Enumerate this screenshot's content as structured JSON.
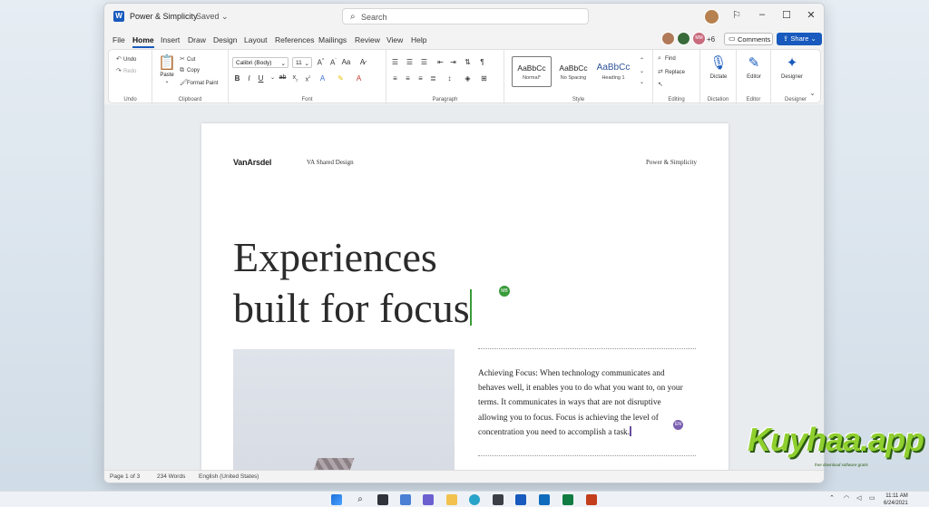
{
  "window": {
    "doc_title": "Power & Simplicity",
    "saved_label": "Saved",
    "search_placeholder": "Search"
  },
  "tabs": [
    "File",
    "Home",
    "Insert",
    "Draw",
    "Design",
    "Layout",
    "References",
    "Mailings",
    "Review",
    "View",
    "Help"
  ],
  "active_tab": "Home",
  "header_actions": {
    "collab_more": "+6",
    "comments_label": "Comments",
    "share_label": "Share"
  },
  "ribbon": {
    "undo": {
      "undo": "Undo",
      "redo": "Redo",
      "label": "Undo"
    },
    "clipboard": {
      "paste": "Paste",
      "cut": "Cut",
      "copy": "Copy",
      "format_painter": "Format Paint",
      "label": "Clipboard"
    },
    "font": {
      "family": "Calibri (Body)",
      "size": "11",
      "label": "Font"
    },
    "paragraph": {
      "label": "Paragraph"
    },
    "styles": {
      "items": [
        {
          "preview": "AaBbCc",
          "name": "Normal*"
        },
        {
          "preview": "AaBbCc",
          "name": "No Spacing"
        },
        {
          "preview": "AaBbCc",
          "name": "Heading 1"
        }
      ],
      "label": "Style"
    },
    "editing": {
      "find": "Find",
      "replace": "Replace",
      "label": "Editing"
    },
    "dictation": {
      "button": "Dictate",
      "label": "Dictation"
    },
    "editor": {
      "button": "Editor",
      "label": "Editor"
    },
    "designer": {
      "button": "Designer",
      "label": "Designer"
    }
  },
  "document": {
    "brand": "VanArsdel",
    "shared_design": "VA Shared Design",
    "header_right": "Power & Simplicity",
    "headline_line1": "Experiences",
    "headline_line2": "built for focus",
    "cursor1_initials": "MB",
    "paragraph": "Achieving Focus: When technology communicates and behaves well, it enables you to do what you want to, on your terms. It communicates in ways that are not disruptive allowing you to focus. Focus is achieving the level of concentration you need to accomplish a task.",
    "cursor2_initials": "EN"
  },
  "status_bar": {
    "page": "Page 1 of 3",
    "words": "234 Words",
    "language": "English (United States)"
  },
  "taskbar": {
    "time": "11:11 AM",
    "date": "6/24/2021"
  },
  "watermark": {
    "text": "Kuyhaa.app",
    "subtitle": "free download software gratis"
  },
  "colors": {
    "word_blue": "#185abd",
    "cursor_green": "#3a9b3a",
    "cursor_purple": "#7a5fb0"
  }
}
